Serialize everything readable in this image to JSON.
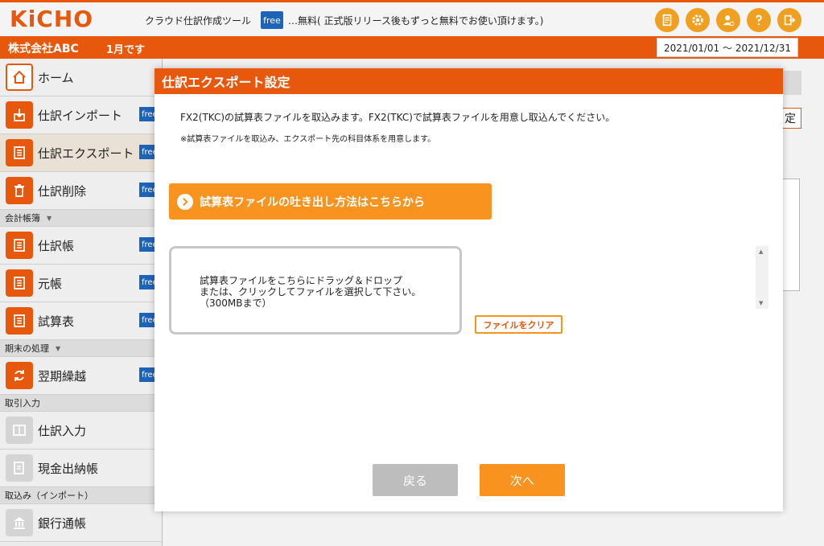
{
  "header": {
    "logo": "KiCHO",
    "tool_name": "クラウド仕訳作成ツール",
    "free_tag": "free",
    "free_note": "…無料( 正式版リリース後もずっと無料でお使い頂けます。)",
    "icons": [
      "document-icon",
      "gear-icon",
      "user-settings-icon",
      "help-icon",
      "logout-icon"
    ]
  },
  "company_bar": {
    "company": "株式会社ABC",
    "month": "1月です",
    "date_range": "2021/01/01 ～ 2021/12/31"
  },
  "sidebar": {
    "items": [
      {
        "label": "ホーム",
        "icon": "home-icon"
      },
      {
        "label": "仕訳インポート",
        "icon": "import-icon",
        "badge": "free"
      },
      {
        "label": "仕訳エクスポート",
        "icon": "export-icon",
        "badge": "free",
        "active": true
      },
      {
        "label": "仕訳削除",
        "icon": "trash-icon",
        "badge": "free"
      }
    ],
    "section_ledger": "会計帳簿",
    "ledger_items": [
      {
        "label": "仕訳帳",
        "icon": "journal-icon",
        "badge": "free"
      },
      {
        "label": "元帳",
        "icon": "ledger-icon",
        "badge": "free"
      },
      {
        "label": "試算表",
        "icon": "trial-balance-icon",
        "badge": "free"
      }
    ],
    "section_closing": "期末の処理",
    "closing_items": [
      {
        "label": "翌期繰越",
        "icon": "carry-forward-icon",
        "badge": "free"
      }
    ],
    "section_entry": "取引入力",
    "entry_items": [
      {
        "label": "仕訳入力",
        "icon": "entry-icon"
      },
      {
        "label": "現金出納帳",
        "icon": "cashbook-icon"
      }
    ],
    "section_import": "取込み（インポート）",
    "import_items": [
      {
        "label": "銀行通帳",
        "icon": "bank-icon"
      }
    ]
  },
  "background": {
    "button_fragment": "定"
  },
  "modal": {
    "title": "仕訳エクスポート設定",
    "desc1": "FX2(TKC)の試算表ファイルを取込みます。FX2(TKC)で試算表ファイルを用意し取込んでください。",
    "desc2": "※試算表ファイルを取込み、エクスポート先の科目体系を用意します。",
    "guide_label": "試算表ファイルの吐き出し方法はこちらから",
    "dropzone_line1": "試算表ファイルをこちらにドラッグ＆ドロップ",
    "dropzone_line2": "または、クリックしてファイルを選択して下さい。",
    "dropzone_line3": "（300MBまで）",
    "clear_label": "ファイルをクリア",
    "back_label": "戻る",
    "next_label": "次へ"
  },
  "colors": {
    "brand_orange": "#e8580c",
    "accent_orange": "#f7931e",
    "free_blue": "#1d63b8",
    "disabled_gray": "#bdbdbd"
  }
}
